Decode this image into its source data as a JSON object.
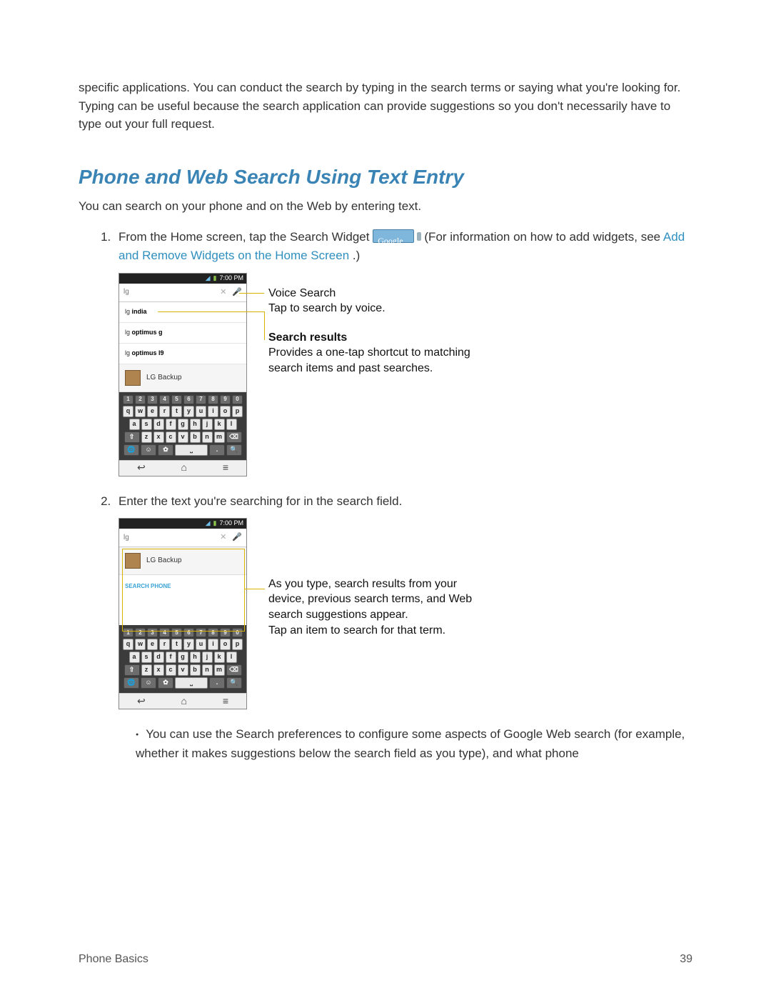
{
  "intro": "specific applications. You can conduct the search by typing in the search terms or saying what you're looking for. Typing can be useful because the search application can provide suggestions so you don't necessarily have to type out your full request.",
  "section_title": "Phone and Web Search Using Text Entry",
  "section_sub": "You can search on your phone and on the Web by entering text.",
  "step1_a": "From the Home screen, tap the Search Widget ",
  "step1_b": ". (For information on how to add widgets, see ",
  "step1_link": "Add and Remove Widgets on the Home Screen",
  "step1_c": ".)",
  "step2": "Enter the text you're searching for in the search field.",
  "bullet": "You can use the Search preferences to configure some aspects of Google Web search (for example, whether it makes suggestions below the search field as you type), and what phone",
  "callout1_title": "Voice Search",
  "callout1_body": "Tap to search by voice.",
  "callout2_title": "Search results",
  "callout2_body": "Provides a one-tap shortcut to matching search items and past searches.",
  "callout3_body": "As you type, search results from your device, previous search terms, and Web search suggestions appear.\nTap an item to search for that term.",
  "phone": {
    "time": "7:00 PM",
    "query": "lg",
    "suggestions": [
      "lg india",
      "lg optimus g",
      "lg optimus l9"
    ],
    "app": "LG Backup",
    "search_phone": "SEARCH PHONE",
    "num_row": [
      "1",
      "2",
      "3",
      "4",
      "5",
      "6",
      "7",
      "8",
      "9",
      "0"
    ],
    "row1": [
      "q",
      "w",
      "e",
      "r",
      "t",
      "y",
      "u",
      "i",
      "o",
      "p"
    ],
    "row2": [
      "a",
      "s",
      "d",
      "f",
      "g",
      "h",
      "j",
      "k",
      "l"
    ],
    "row3": [
      "z",
      "x",
      "c",
      "v",
      "b",
      "n",
      "m"
    ],
    "nav": [
      "↩",
      "⌂",
      "≡"
    ]
  },
  "google_label": "Google",
  "footer_left": "Phone Basics",
  "footer_right": "39"
}
